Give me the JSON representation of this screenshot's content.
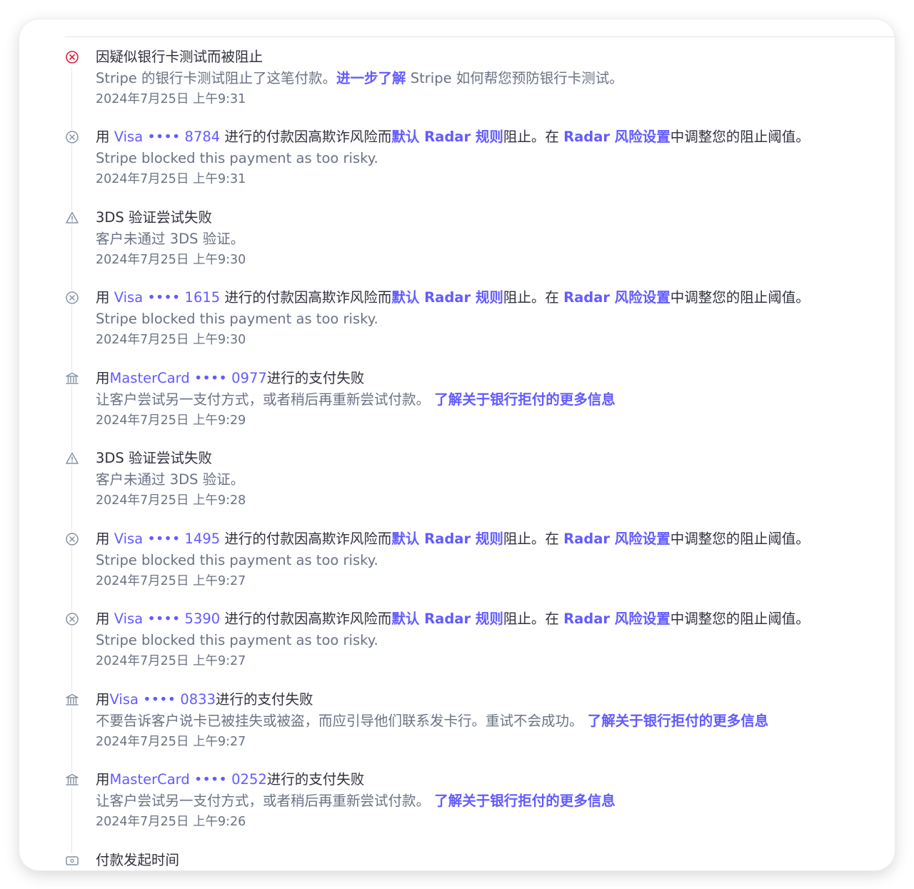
{
  "header": {
    "clipped_title": "· · · ·"
  },
  "events": [
    {
      "icon": "x-circle-red-icon",
      "title": [
        {
          "t": "因疑似银行卡测试而被阻止"
        }
      ],
      "desc": [
        {
          "t": "Stripe 的银行卡测试阻止了这笔付款。"
        },
        {
          "t": "进一步了解",
          "link": true,
          "bold": true
        },
        {
          "t": " Stripe 如何帮您预防银行卡测试。"
        }
      ],
      "time": "2024年7月25日 上午9:31"
    },
    {
      "icon": "x-circle-icon",
      "title": [
        {
          "t": "用 "
        },
        {
          "t": "Visa •••• 8784",
          "link": true
        },
        {
          "t": " 进行的付款因高欺诈风险而"
        },
        {
          "t": "默认 Radar 规则",
          "link": true,
          "bold": true
        },
        {
          "t": "阻止。在 "
        },
        {
          "t": "Radar 风险设置",
          "link": true,
          "bold": true
        },
        {
          "t": "中调整您的阻止阈值。"
        }
      ],
      "desc": [
        {
          "t": "Stripe blocked this payment as too risky."
        }
      ],
      "time": "2024年7月25日 上午9:31"
    },
    {
      "icon": "warning-triangle-icon",
      "title": [
        {
          "t": "3DS 验证尝试失败"
        }
      ],
      "desc": [
        {
          "t": "客户未通过 3DS 验证。"
        }
      ],
      "time": "2024年7月25日 上午9:30"
    },
    {
      "icon": "x-circle-icon",
      "title": [
        {
          "t": "用 "
        },
        {
          "t": "Visa •••• 1615",
          "link": true
        },
        {
          "t": " 进行的付款因高欺诈风险而"
        },
        {
          "t": "默认 Radar 规则",
          "link": true,
          "bold": true
        },
        {
          "t": "阻止。在 "
        },
        {
          "t": "Radar 风险设置",
          "link": true,
          "bold": true
        },
        {
          "t": "中调整您的阻止阈值。"
        }
      ],
      "desc": [
        {
          "t": "Stripe blocked this payment as too risky."
        }
      ],
      "time": "2024年7月25日 上午9:30"
    },
    {
      "icon": "bank-icon",
      "title": [
        {
          "t": "用"
        },
        {
          "t": "MasterCard •••• 0977",
          "link": true
        },
        {
          "t": "进行的支付失败"
        }
      ],
      "desc": [
        {
          "t": "让客户尝试另一支付方式，或者稍后再重新尝试付款。 "
        },
        {
          "t": "了解关于银行拒付的更多信息",
          "link": true,
          "bold": true
        }
      ],
      "time": "2024年7月25日 上午9:29"
    },
    {
      "icon": "warning-triangle-icon",
      "title": [
        {
          "t": "3DS 验证尝试失败"
        }
      ],
      "desc": [
        {
          "t": "客户未通过 3DS 验证。"
        }
      ],
      "time": "2024年7月25日 上午9:28"
    },
    {
      "icon": "x-circle-icon",
      "title": [
        {
          "t": "用 "
        },
        {
          "t": "Visa •••• 1495",
          "link": true
        },
        {
          "t": " 进行的付款因高欺诈风险而"
        },
        {
          "t": "默认 Radar 规则",
          "link": true,
          "bold": true
        },
        {
          "t": "阻止。在 "
        },
        {
          "t": "Radar 风险设置",
          "link": true,
          "bold": true
        },
        {
          "t": "中调整您的阻止阈值。"
        }
      ],
      "desc": [
        {
          "t": "Stripe blocked this payment as too risky."
        }
      ],
      "time": "2024年7月25日 上午9:27"
    },
    {
      "icon": "x-circle-icon",
      "title": [
        {
          "t": "用 "
        },
        {
          "t": "Visa •••• 5390",
          "link": true
        },
        {
          "t": " 进行的付款因高欺诈风险而"
        },
        {
          "t": "默认 Radar 规则",
          "link": true,
          "bold": true
        },
        {
          "t": "阻止。在 "
        },
        {
          "t": "Radar 风险设置",
          "link": true,
          "bold": true
        },
        {
          "t": "中调整您的阻止阈值。"
        }
      ],
      "desc": [
        {
          "t": "Stripe blocked this payment as too risky."
        }
      ],
      "time": "2024年7月25日 上午9:27"
    },
    {
      "icon": "bank-icon",
      "title": [
        {
          "t": "用"
        },
        {
          "t": "Visa •••• 0833",
          "link": true
        },
        {
          "t": "进行的支付失败"
        }
      ],
      "desc": [
        {
          "t": "不要告诉客户说卡已被挂失或被盗，而应引导他们联系发卡行。重试不会成功。 "
        },
        {
          "t": "了解关于银行拒付的更多信息",
          "link": true,
          "bold": true
        }
      ],
      "time": "2024年7月25日 上午9:27"
    },
    {
      "icon": "bank-icon",
      "title": [
        {
          "t": "用"
        },
        {
          "t": "MasterCard •••• 0252",
          "link": true
        },
        {
          "t": "进行的支付失败"
        }
      ],
      "desc": [
        {
          "t": "让客户尝试另一支付方式，或者稍后再重新尝试付款。 "
        },
        {
          "t": "了解关于银行拒付的更多信息",
          "link": true,
          "bold": true
        }
      ],
      "time": "2024年7月25日 上午9:26"
    },
    {
      "icon": "payment-icon",
      "title": [
        {
          "t": "付款发起时间"
        }
      ],
      "desc": [],
      "time": ""
    }
  ]
}
